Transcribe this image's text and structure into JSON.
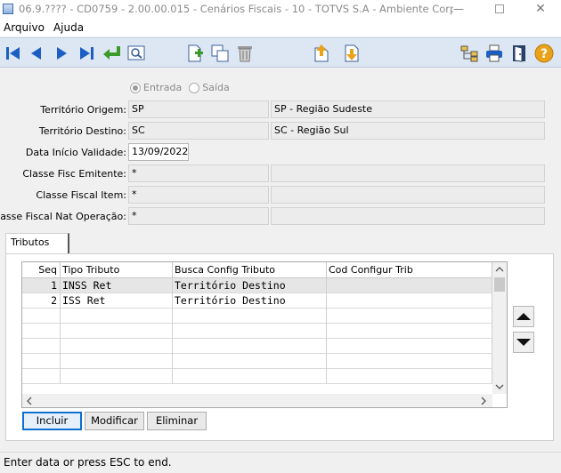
{
  "window": {
    "title": "06.9.???? - CD0759 - 2.00.00.015 - Cenários Fiscais - 10 - TOTVS S.A - Ambiente Corporati...",
    "minimize": "—",
    "close": "✕"
  },
  "menu": {
    "items": [
      "Arquivo",
      "Ajuda"
    ]
  },
  "toolbar": {
    "icons": [
      "first-record",
      "previous-record",
      "next-record",
      "last-record",
      "go-to",
      "search",
      "add",
      "copy",
      "delete",
      "upload",
      "download",
      "tree",
      "print",
      "exit",
      "help"
    ],
    "help_glyph": "?"
  },
  "form": {
    "radio": {
      "options": [
        "Entrada",
        "Saída"
      ],
      "selected": "Entrada"
    },
    "territorio_origem": {
      "label": "Território Origem:",
      "code": "SP",
      "desc": "SP - Região Sudeste"
    },
    "territorio_destino": {
      "label": "Território Destino:",
      "code": "SC",
      "desc": "SC - Região Sul"
    },
    "data_inicio": {
      "label": "Data Início Validade:",
      "value": "13/09/2022"
    },
    "classe_emitente": {
      "label": "Classe Fisc Emitente:",
      "value": "*",
      "desc": ""
    },
    "classe_item": {
      "label": "Classe Fiscal Item:",
      "value": "*",
      "desc": ""
    },
    "classe_nat": {
      "label": "Classe Fiscal Nat Operação:",
      "value": "*",
      "desc": ""
    }
  },
  "tab": {
    "label": "Tributos"
  },
  "grid": {
    "columns": [
      "Seq",
      "Tipo Tributo",
      "Busca Config Tributo",
      "Cod Configur Trib"
    ],
    "rows": [
      {
        "seq": "1",
        "tipo": "INSS Ret",
        "busca": "Território Destino",
        "cod": ""
      },
      {
        "seq": "2",
        "tipo": "ISS Ret",
        "busca": "Território Destino",
        "cod": ""
      }
    ]
  },
  "buttons": {
    "incluir": "Incluir",
    "modificar": "Modificar",
    "eliminar": "Eliminar"
  },
  "status": {
    "text": "Enter data or press ESC to end."
  },
  "colors": {
    "toolbar_bg": "#dde7f3",
    "icon_blue": "#1c5fc4",
    "icon_green": "#3a9a2a",
    "help_orange": "#e9a21a",
    "focus_blue": "#0c6fd1"
  }
}
